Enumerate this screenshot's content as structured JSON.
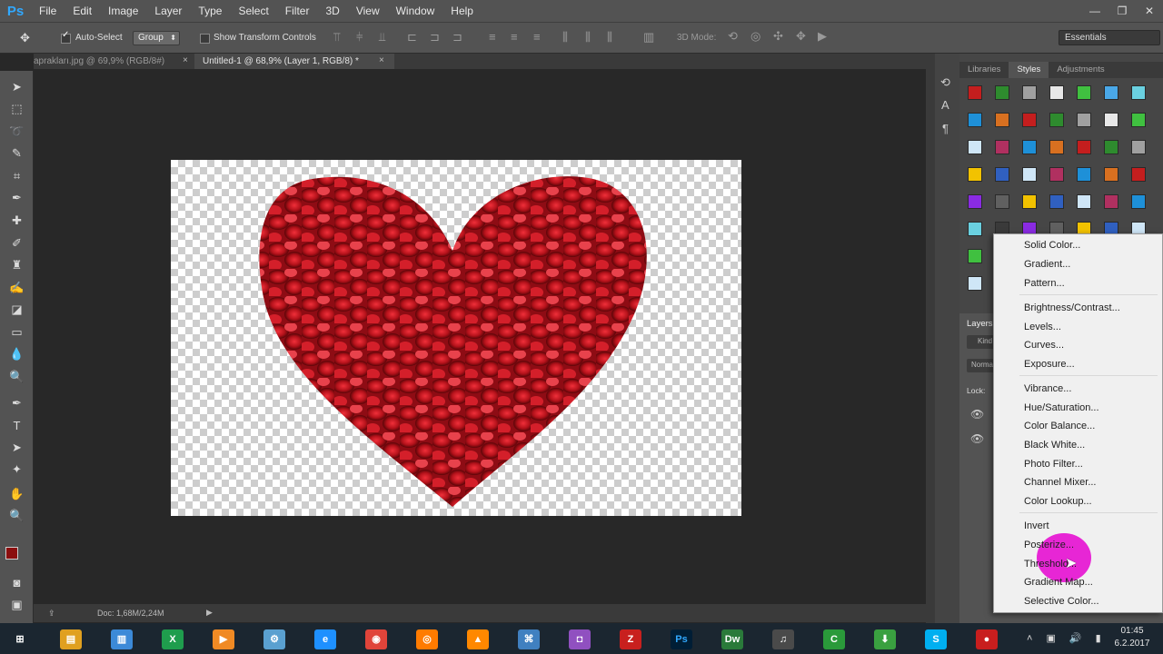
{
  "app": {
    "logo": "Ps"
  },
  "menubar": {
    "items": [
      "File",
      "Edit",
      "Image",
      "Layer",
      "Type",
      "Select",
      "Filter",
      "3D",
      "View",
      "Window",
      "Help"
    ]
  },
  "window_controls": {
    "minimize": "—",
    "restore": "❐",
    "close": "✕"
  },
  "options": {
    "auto_select_label": "Auto-Select",
    "auto_select_checked": true,
    "group_value": "Group",
    "show_transform_label": "Show Transform Controls",
    "mode_3d_label": "3D Mode:",
    "workspace_value": "Essentials"
  },
  "tabs": [
    {
      "label": "aprakları.jpg @ 69,9% (RGB/8#)",
      "close": "×"
    },
    {
      "label": "Untitled-1 @ 68,9% (Layer 1, RGB/8) *",
      "close": "×"
    }
  ],
  "status": {
    "doc": "Doc: 1,68M/2,24M"
  },
  "panels": {
    "tabs": [
      "Libraries",
      "Styles",
      "Adjustments"
    ],
    "active_tab": "Styles",
    "layers_title": "Layers",
    "layers_kind": "Kind",
    "layers_mode": "Normal",
    "layers_lock": "Lock:"
  },
  "adjustment_menu": {
    "groups": [
      [
        "Solid Color...",
        "Gradient...",
        "Pattern..."
      ],
      [
        "Brightness/Contrast...",
        "Levels...",
        "Curves...",
        "Exposure..."
      ],
      [
        "Vibrance...",
        "Hue/Saturation...",
        "Color Balance...",
        "Black  White...",
        "Photo Filter...",
        "Channel Mixer...",
        "Color Lookup..."
      ],
      [
        "Invert",
        "Posterize...",
        "Threshold...",
        "Gradient Map...",
        "Selective Color..."
      ]
    ]
  },
  "colors": {
    "foreground": "#8b0e0e",
    "background": "#1c5ab4",
    "accent": "#31a8ff",
    "heart": "#b5121b"
  },
  "taskbar": {
    "icons": [
      "windows-start",
      "file-explorer",
      "documents",
      "excel",
      "media-player",
      "settings-tool",
      "internet-explorer",
      "chrome",
      "firefox",
      "vlc",
      "network",
      "camera",
      "filezilla",
      "photoshop",
      "dreamweaver",
      "headphones",
      "camtasia",
      "downloads",
      "skype",
      "recorder"
    ],
    "clock_time": "01:45",
    "clock_date": "6.2.2017"
  }
}
